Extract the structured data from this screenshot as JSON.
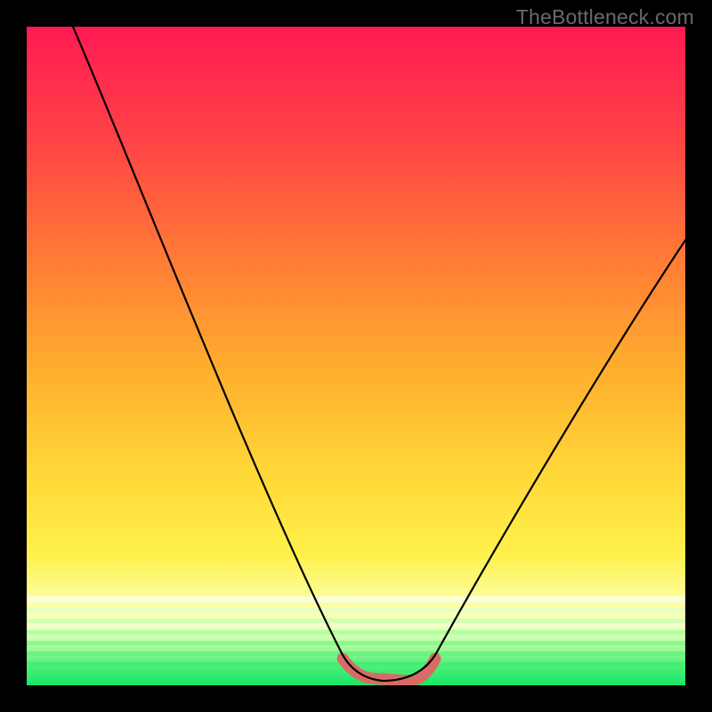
{
  "watermark": "TheBottleneck.com",
  "colors": {
    "frame": "#000000",
    "grad_top": "#ff1a52",
    "grad_mid1": "#ff5a3a",
    "grad_mid2": "#ff9e2f",
    "grad_mid3": "#ffd438",
    "grad_mid4": "#fff24a",
    "grad_band": "#f8ffbc",
    "grad_bottom": "#17e86a",
    "curve": "#000000",
    "highlight": "#d96b66"
  },
  "chart_data": {
    "type": "line",
    "title": "",
    "xlabel": "",
    "ylabel": "",
    "xlim": [
      0,
      100
    ],
    "ylim": [
      0,
      100
    ],
    "axes_visible": false,
    "grid": false,
    "series": [
      {
        "name": "bottleneck-curve",
        "x": [
          7,
          10,
          15,
          20,
          25,
          30,
          35,
          40,
          45,
          48,
          50,
          52,
          55,
          58,
          60,
          62,
          65,
          70,
          75,
          80,
          85,
          90,
          95,
          100
        ],
        "y": [
          100,
          94,
          84,
          73,
          63,
          52,
          42,
          31,
          18,
          8,
          3,
          1,
          0.5,
          0.5,
          1,
          3,
          8,
          17,
          27,
          36,
          45,
          53,
          61,
          68
        ]
      },
      {
        "name": "optimal-range-highlight",
        "x": [
          48,
          50,
          52,
          55,
          58,
          60,
          62
        ],
        "y": [
          4,
          2,
          1,
          0.5,
          1,
          2,
          4
        ]
      }
    ],
    "annotations": []
  }
}
